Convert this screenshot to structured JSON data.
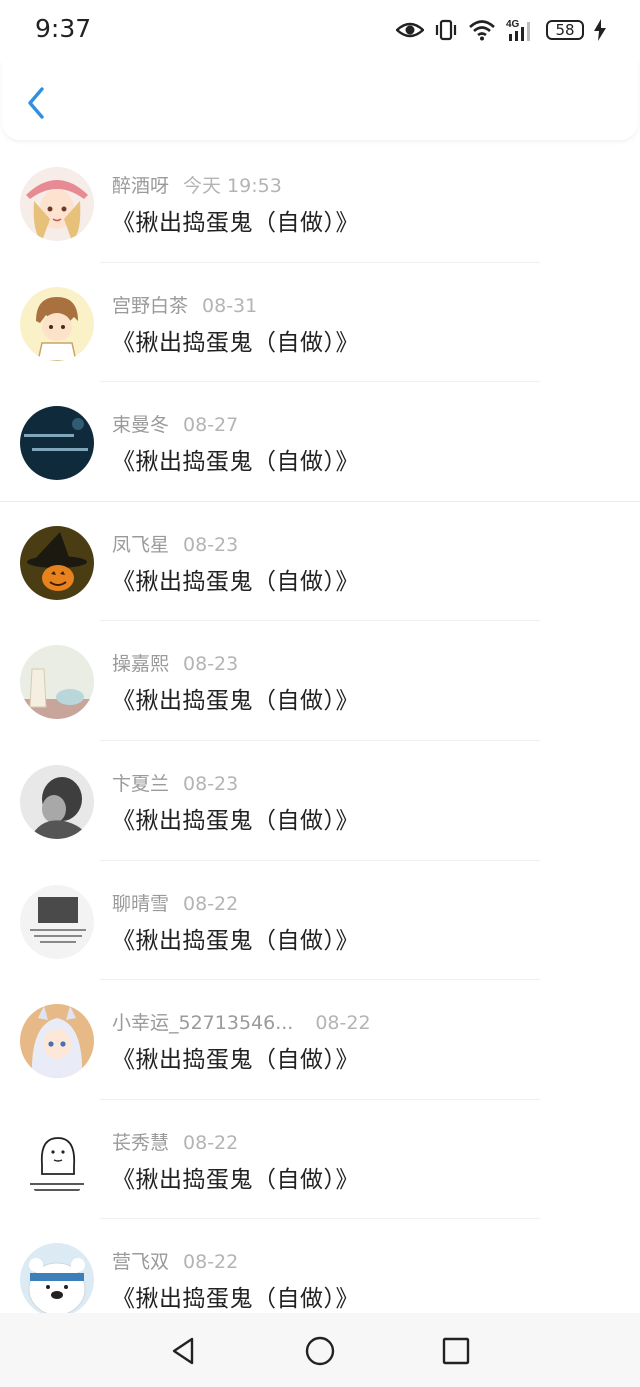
{
  "status_bar": {
    "time": "9:37",
    "network": "4G",
    "battery": "58",
    "icons": [
      "eye-icon",
      "vibrate-icon",
      "wifi-icon",
      "signal-icon",
      "battery-icon",
      "charging-icon"
    ]
  },
  "header": {
    "back_icon": "chevron-left-icon"
  },
  "comments": [
    {
      "name": "醉酒呀",
      "date": "今天 19:53",
      "text": "《揪出捣蛋鬼（自做）》"
    },
    {
      "name": "宫野白茶",
      "date": "08-31",
      "text": "《揪出捣蛋鬼（自做）》"
    },
    {
      "name": "束曼冬",
      "date": "08-27",
      "text": "《揪出捣蛋鬼（自做）》"
    },
    {
      "name": "凤飞星",
      "date": "08-23",
      "text": "《揪出捣蛋鬼（自做）》"
    },
    {
      "name": "操嘉熙",
      "date": "08-23",
      "text": "《揪出捣蛋鬼（自做）》"
    },
    {
      "name": "卞夏兰",
      "date": "08-23",
      "text": "《揪出捣蛋鬼（自做）》"
    },
    {
      "name": "聊晴雪",
      "date": "08-22",
      "text": "《揪出捣蛋鬼（自做）》"
    },
    {
      "name": "小幸运_52713546...",
      "date": "08-22",
      "text": "《揪出捣蛋鬼（自做）》"
    },
    {
      "name": "苌秀慧",
      "date": "08-22",
      "text": "《揪出捣蛋鬼（自做）》"
    },
    {
      "name": "营飞双",
      "date": "08-22",
      "text": "《揪出捣蛋鬼（自做）》"
    }
  ],
  "nav_bar": {
    "icons": [
      "back-triangle-icon",
      "home-circle-icon",
      "recents-square-icon"
    ]
  },
  "colors": {
    "accent": "#2f8fe0",
    "name_text": "#9a9a9a",
    "date_text": "#b4b4b4",
    "body_text": "#222222"
  }
}
